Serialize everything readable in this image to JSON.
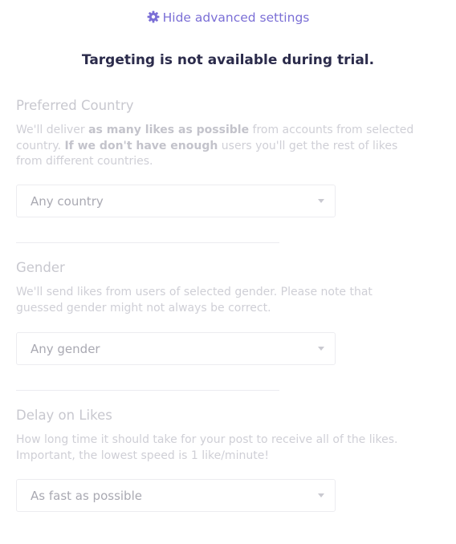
{
  "header": {
    "toggle_label": "Hide advanced settings",
    "toggle_icon": "gear-icon",
    "accent_color": "#7b6fd6"
  },
  "notice": {
    "text": "Targeting is not available during trial."
  },
  "country": {
    "title": "Preferred Country",
    "desc_1": "We'll deliver ",
    "desc_bold_1": "as many likes as possible",
    "desc_2": " from accounts from selected country. ",
    "desc_bold_2": "If we don't have enough",
    "desc_3": " users you'll get the rest of likes from different countries.",
    "select_value": "Any country"
  },
  "gender": {
    "title": "Gender",
    "desc": "We'll send likes from users of selected gender. Please note that guessed gender might not always be correct.",
    "select_value": "Any gender"
  },
  "delay": {
    "title": "Delay on Likes",
    "desc": "How long time it should take for your post to receive all of the likes. Important, the lowest speed is 1 like/minute!",
    "select_value": "As fast as possible"
  }
}
